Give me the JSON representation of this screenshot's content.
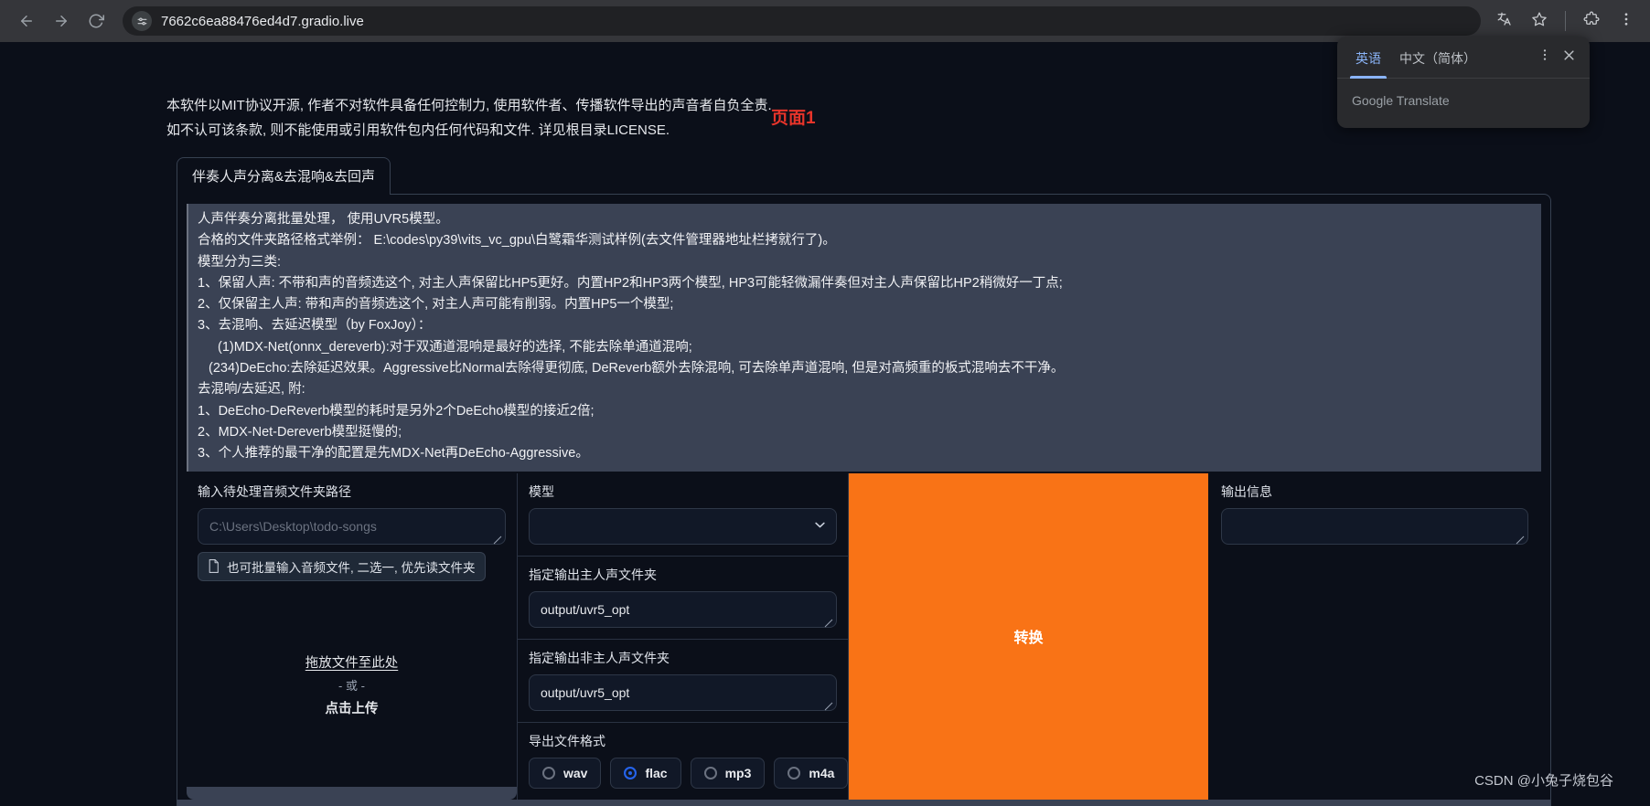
{
  "browser": {
    "back_icon": "back-arrow-icon",
    "forward_icon": "forward-arrow-icon",
    "reload_icon": "reload-icon",
    "site_info_icon": "site-settings-icon",
    "url": "7662c6ea88476ed4d7.gradio.live",
    "translate_icon": "translate-icon",
    "bookmark_icon": "star-icon",
    "extensions_icon": "extensions-icon",
    "menu_icon": "three-dot-menu-icon"
  },
  "translate_popup": {
    "tabs": [
      {
        "label": "英语",
        "active": true
      },
      {
        "label": "中文（简体）",
        "active": false
      }
    ],
    "options_icon": "three-dot-vertical-icon",
    "close_icon": "close-icon",
    "brand": "Google Translate"
  },
  "notice": {
    "line1": "本软件以MIT协议开源, 作者不对软件具备任何控制力, 使用软件者、传播软件导出的声音者自负全责.",
    "line2": "如不认可该条款, 则不能使用或引用软件包内任何代码和文件. 详见根目录LICENSE.",
    "page_marker": "页面1"
  },
  "tab": {
    "label": "伴奏人声分离&去混响&去回声"
  },
  "description": {
    "lines": [
      {
        "text": "人声伴奏分离批量处理， 使用UVR5模型。",
        "indent": 0
      },
      {
        "text": "合格的文件夹路径格式举例：  E:\\codes\\py39\\vits_vc_gpu\\白鹭霜华测试样例(去文件管理器地址栏拷就行了)。",
        "indent": 0
      },
      {
        "text": "模型分为三类:",
        "indent": 0
      },
      {
        "text": "1、保留人声: 不带和声的音频选这个, 对主人声保留比HP5更好。内置HP2和HP3两个模型, HP3可能轻微漏伴奏但对主人声保留比HP2稍微好一丁点;",
        "indent": 0
      },
      {
        "text": "2、仅保留主人声: 带和声的音频选这个, 对主人声可能有削弱。内置HP5一个模型;",
        "indent": 0
      },
      {
        "text": "3、去混响、去延迟模型（by FoxJoy）：",
        "indent": 0
      },
      {
        "text": "(1)MDX-Net(onnx_dereverb):对于双通道混响是最好的选择, 不能去除单通道混响;",
        "indent": 1
      },
      {
        "text": "(234)DeEcho:去除延迟效果。Aggressive比Normal去除得更彻底, DeReverb额外去除混响, 可去除单声道混响, 但是对高频重的板式混响去不干净。",
        "indent": 2
      },
      {
        "text": "去混响/去延迟, 附:",
        "indent": 0
      },
      {
        "text": "1、DeEcho-DeReverb模型的耗时是另外2个DeEcho模型的接近2倍;",
        "indent": 0
      },
      {
        "text": "2、MDX-Net-Dereverb模型挺慢的;",
        "indent": 0
      },
      {
        "text": "3、个人推荐的最干净的配置是先MDX-Net再DeEcho-Aggressive。",
        "indent": 0
      }
    ]
  },
  "left_column": {
    "input_path_label": "输入待处理音频文件夹路径",
    "input_path_value": "",
    "input_path_placeholder": "C:\\Users\\Desktop\\todo-songs",
    "hint_badge": "也可批量输入音频文件, 二选一, 优先读文件夹",
    "hint_icon": "file-icon",
    "dropzone_main": "拖放文件至此处",
    "dropzone_or": "- 或 -",
    "dropzone_click": "点击上传"
  },
  "middle_column": {
    "model_label": "模型",
    "model_value": "",
    "model_caret_icon": "chevron-down-icon",
    "vocal_output_label": "指定输出主人声文件夹",
    "vocal_output_value": "output/uvr5_opt",
    "inst_output_label": "指定输出非主人声文件夹",
    "inst_output_value": "output/uvr5_opt",
    "format_label": "导出文件格式",
    "format_options": [
      {
        "label": "wav",
        "selected": false
      },
      {
        "label": "flac",
        "selected": true
      },
      {
        "label": "mp3",
        "selected": false
      },
      {
        "label": "m4a",
        "selected": false
      }
    ]
  },
  "convert_button": {
    "label": "转换",
    "color": "#f97316"
  },
  "right_column": {
    "output_label": "输出信息",
    "output_value": ""
  },
  "watermark": "CSDN @小兔子烧包谷"
}
